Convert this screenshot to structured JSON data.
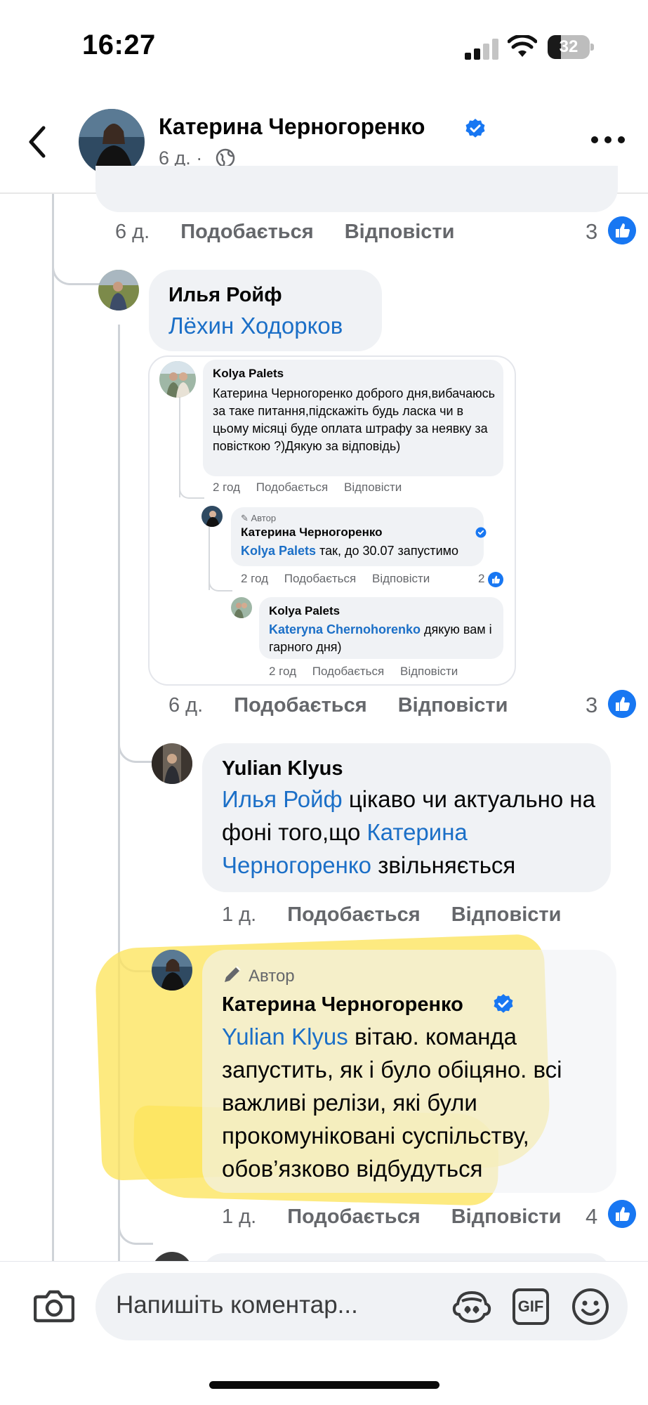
{
  "status_bar": {
    "time": "16:27",
    "battery": "32",
    "battery_level": 0.32
  },
  "header": {
    "name": "Катерина Черногоренко",
    "meta": "6 д. ·",
    "back_icon": "chevron-left-icon",
    "more_icon": "ellipsis-icon",
    "privacy_icon": "globe-icon"
  },
  "comments": {
    "c0": {
      "time": "6 д.",
      "like": "Подобається",
      "reply": "Відповісти",
      "likes": "3"
    },
    "c1": {
      "author": "Илья Ройф",
      "mention": "Лёхин Ходорков",
      "time": "6 д.",
      "like": "Подобається",
      "reply": "Відповісти",
      "likes": "3"
    },
    "c2": {
      "author": "Yulian Klyus",
      "mention1": "Илья Ройф",
      "text1": " цікаво чи актуально на фоні того,що ",
      "mention2": "Катерина Черногоренко",
      "text2": " звільняється",
      "time": "1 д.",
      "like": "Подобається",
      "reply": "Відповісти"
    },
    "c3": {
      "tag": "Автор",
      "author": "Катерина Черногоренко",
      "mention": "Yulian Klyus",
      "text": " вітаю. команда запустить, як і було обіцяно. всі важливі релізи, які були прокомуніковані суспільству, обов’язково відбудуться",
      "time": "1 д.",
      "like": "Подобається",
      "reply": "Відповісти",
      "likes": "4"
    }
  },
  "embedded": {
    "e1": {
      "author": "Kolya Palets",
      "text": "Катерина Черногоренко доброго дня,вибачаюсь за таке питання,підскажіть будь ласка чи в цьому місяці буде оплата штрафу за неявку за повісткою ?)Дякую за відповідь)",
      "time": "2 год",
      "like": "Подобається",
      "reply": "Відповісти"
    },
    "e2": {
      "tag": "Автор",
      "author": "Катерина Черногоренко",
      "mention": "Kolya Palets",
      "text": " так, до 30.07 запустимо",
      "time": "2 год",
      "like": "Подобається",
      "reply": "Відповісти",
      "likes": "2"
    },
    "e3": {
      "author": "Kolya Palets",
      "mention": "Kateryna Chernohorenko",
      "text": " дякую вам і гарного дня)",
      "time": "2 год",
      "like": "Подобається",
      "reply": "Відповісти"
    }
  },
  "composer": {
    "placeholder": "Напишіть коментар...",
    "camera_icon": "camera-icon",
    "avatar_icon": "avatar-sticker-icon",
    "gif_label": "GIF",
    "emoji_icon": "emoji-icon"
  },
  "colors": {
    "accent": "#1877f2",
    "mention": "#1b6fc7",
    "highlight": "#fce45c"
  }
}
